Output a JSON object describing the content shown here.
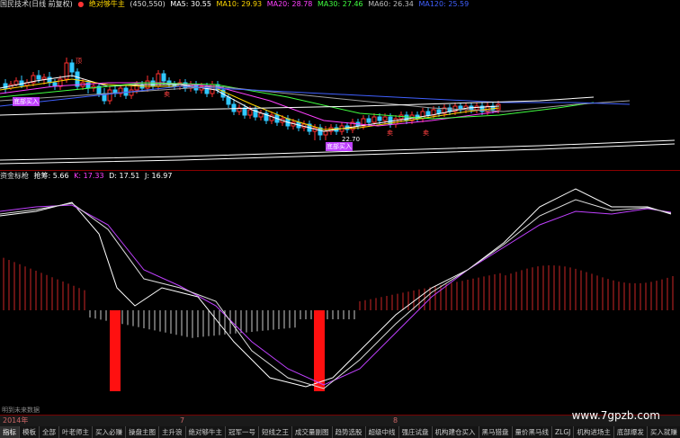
{
  "top_header": {
    "indicator_name": "国民技术(日线 前复权)",
    "strategy_name": "绝对够牛主",
    "range": "(450,550)",
    "ma5": "MA5: 30.55",
    "ma10": "MA10: 29.93",
    "ma20": "MA20: 28.78",
    "ma30": "MA30: 27.46",
    "ma60": "MA60: 26.34",
    "ma120": "MA120: 25.59"
  },
  "mid_header": {
    "name": "资金标枪",
    "label_a": "抢筹: 5.66",
    "k": "K: 17.33",
    "d": "D: 17.51",
    "j": "J: 16.97"
  },
  "chart_labels": {
    "buy_tag_1": "底部买入",
    "buy_tag_2": "底部买入",
    "price_mark": "22.70",
    "sell_tag_1": "卖",
    "sell_tag_2": "卖",
    "sell_tag_3": "卖",
    "peak_tag": "顶"
  },
  "footer_note": "明到未来数据",
  "timebar": {
    "year": "2014年",
    "m7": "7",
    "m8": "8"
  },
  "tabs": [
    "指标",
    "模板",
    "全部",
    "叶老师主",
    "买入必赚",
    "操盘主图",
    "主升浪",
    "绝对够牛主",
    "冠军一号",
    "短线之王",
    "成交量副图",
    "趋势选股",
    "超级中线",
    "强庄试盘",
    "机构建仓买入",
    "黑马猎盘",
    "量价黑马线",
    "ZLGJ",
    "机构进场主",
    "底部爆发",
    "买入就赚",
    "买卖"
  ],
  "watermark": "www.7gpzb.com",
  "colors": {
    "up": "#ff3030",
    "down": "#30c8ff",
    "ma5": "#ffffff",
    "ma10": "#ffd700",
    "ma20": "#ff40ff",
    "ma30": "#40ff40",
    "ma60": "#a0a0a0",
    "ma120": "#4060ff"
  }
}
